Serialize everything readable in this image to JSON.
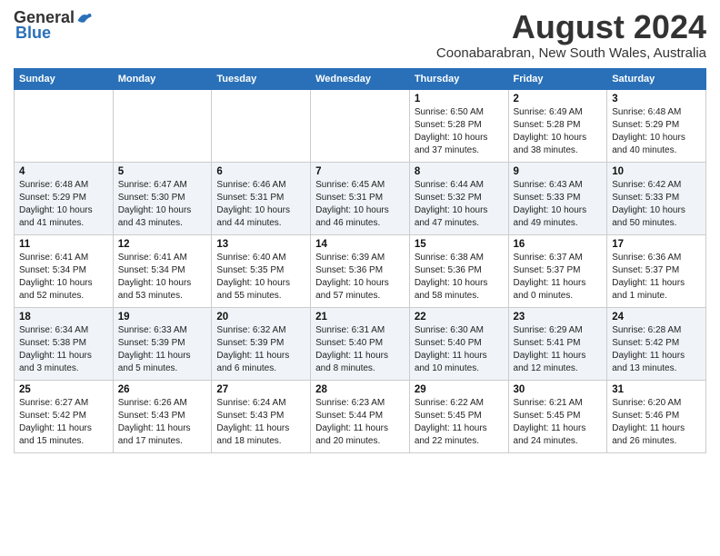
{
  "header": {
    "logo_general": "General",
    "logo_blue": "Blue",
    "month": "August 2024",
    "location": "Coonabarabran, New South Wales, Australia"
  },
  "weekdays": [
    "Sunday",
    "Monday",
    "Tuesday",
    "Wednesday",
    "Thursday",
    "Friday",
    "Saturday"
  ],
  "weeks": [
    [
      null,
      null,
      null,
      null,
      {
        "day": "1",
        "sunrise": "Sunrise: 6:50 AM",
        "sunset": "Sunset: 5:28 PM",
        "daylight": "Daylight: 10 hours and 37 minutes."
      },
      {
        "day": "2",
        "sunrise": "Sunrise: 6:49 AM",
        "sunset": "Sunset: 5:28 PM",
        "daylight": "Daylight: 10 hours and 38 minutes."
      },
      {
        "day": "3",
        "sunrise": "Sunrise: 6:48 AM",
        "sunset": "Sunset: 5:29 PM",
        "daylight": "Daylight: 10 hours and 40 minutes."
      }
    ],
    [
      {
        "day": "4",
        "sunrise": "Sunrise: 6:48 AM",
        "sunset": "Sunset: 5:29 PM",
        "daylight": "Daylight: 10 hours and 41 minutes."
      },
      {
        "day": "5",
        "sunrise": "Sunrise: 6:47 AM",
        "sunset": "Sunset: 5:30 PM",
        "daylight": "Daylight: 10 hours and 43 minutes."
      },
      {
        "day": "6",
        "sunrise": "Sunrise: 6:46 AM",
        "sunset": "Sunset: 5:31 PM",
        "daylight": "Daylight: 10 hours and 44 minutes."
      },
      {
        "day": "7",
        "sunrise": "Sunrise: 6:45 AM",
        "sunset": "Sunset: 5:31 PM",
        "daylight": "Daylight: 10 hours and 46 minutes."
      },
      {
        "day": "8",
        "sunrise": "Sunrise: 6:44 AM",
        "sunset": "Sunset: 5:32 PM",
        "daylight": "Daylight: 10 hours and 47 minutes."
      },
      {
        "day": "9",
        "sunrise": "Sunrise: 6:43 AM",
        "sunset": "Sunset: 5:33 PM",
        "daylight": "Daylight: 10 hours and 49 minutes."
      },
      {
        "day": "10",
        "sunrise": "Sunrise: 6:42 AM",
        "sunset": "Sunset: 5:33 PM",
        "daylight": "Daylight: 10 hours and 50 minutes."
      }
    ],
    [
      {
        "day": "11",
        "sunrise": "Sunrise: 6:41 AM",
        "sunset": "Sunset: 5:34 PM",
        "daylight": "Daylight: 10 hours and 52 minutes."
      },
      {
        "day": "12",
        "sunrise": "Sunrise: 6:41 AM",
        "sunset": "Sunset: 5:34 PM",
        "daylight": "Daylight: 10 hours and 53 minutes."
      },
      {
        "day": "13",
        "sunrise": "Sunrise: 6:40 AM",
        "sunset": "Sunset: 5:35 PM",
        "daylight": "Daylight: 10 hours and 55 minutes."
      },
      {
        "day": "14",
        "sunrise": "Sunrise: 6:39 AM",
        "sunset": "Sunset: 5:36 PM",
        "daylight": "Daylight: 10 hours and 57 minutes."
      },
      {
        "day": "15",
        "sunrise": "Sunrise: 6:38 AM",
        "sunset": "Sunset: 5:36 PM",
        "daylight": "Daylight: 10 hours and 58 minutes."
      },
      {
        "day": "16",
        "sunrise": "Sunrise: 6:37 AM",
        "sunset": "Sunset: 5:37 PM",
        "daylight": "Daylight: 11 hours and 0 minutes."
      },
      {
        "day": "17",
        "sunrise": "Sunrise: 6:36 AM",
        "sunset": "Sunset: 5:37 PM",
        "daylight": "Daylight: 11 hours and 1 minute."
      }
    ],
    [
      {
        "day": "18",
        "sunrise": "Sunrise: 6:34 AM",
        "sunset": "Sunset: 5:38 PM",
        "daylight": "Daylight: 11 hours and 3 minutes."
      },
      {
        "day": "19",
        "sunrise": "Sunrise: 6:33 AM",
        "sunset": "Sunset: 5:39 PM",
        "daylight": "Daylight: 11 hours and 5 minutes."
      },
      {
        "day": "20",
        "sunrise": "Sunrise: 6:32 AM",
        "sunset": "Sunset: 5:39 PM",
        "daylight": "Daylight: 11 hours and 6 minutes."
      },
      {
        "day": "21",
        "sunrise": "Sunrise: 6:31 AM",
        "sunset": "Sunset: 5:40 PM",
        "daylight": "Daylight: 11 hours and 8 minutes."
      },
      {
        "day": "22",
        "sunrise": "Sunrise: 6:30 AM",
        "sunset": "Sunset: 5:40 PM",
        "daylight": "Daylight: 11 hours and 10 minutes."
      },
      {
        "day": "23",
        "sunrise": "Sunrise: 6:29 AM",
        "sunset": "Sunset: 5:41 PM",
        "daylight": "Daylight: 11 hours and 12 minutes."
      },
      {
        "day": "24",
        "sunrise": "Sunrise: 6:28 AM",
        "sunset": "Sunset: 5:42 PM",
        "daylight": "Daylight: 11 hours and 13 minutes."
      }
    ],
    [
      {
        "day": "25",
        "sunrise": "Sunrise: 6:27 AM",
        "sunset": "Sunset: 5:42 PM",
        "daylight": "Daylight: 11 hours and 15 minutes."
      },
      {
        "day": "26",
        "sunrise": "Sunrise: 6:26 AM",
        "sunset": "Sunset: 5:43 PM",
        "daylight": "Daylight: 11 hours and 17 minutes."
      },
      {
        "day": "27",
        "sunrise": "Sunrise: 6:24 AM",
        "sunset": "Sunset: 5:43 PM",
        "daylight": "Daylight: 11 hours and 18 minutes."
      },
      {
        "day": "28",
        "sunrise": "Sunrise: 6:23 AM",
        "sunset": "Sunset: 5:44 PM",
        "daylight": "Daylight: 11 hours and 20 minutes."
      },
      {
        "day": "29",
        "sunrise": "Sunrise: 6:22 AM",
        "sunset": "Sunset: 5:45 PM",
        "daylight": "Daylight: 11 hours and 22 minutes."
      },
      {
        "day": "30",
        "sunrise": "Sunrise: 6:21 AM",
        "sunset": "Sunset: 5:45 PM",
        "daylight": "Daylight: 11 hours and 24 minutes."
      },
      {
        "day": "31",
        "sunrise": "Sunrise: 6:20 AM",
        "sunset": "Sunset: 5:46 PM",
        "daylight": "Daylight: 11 hours and 26 minutes."
      }
    ]
  ]
}
